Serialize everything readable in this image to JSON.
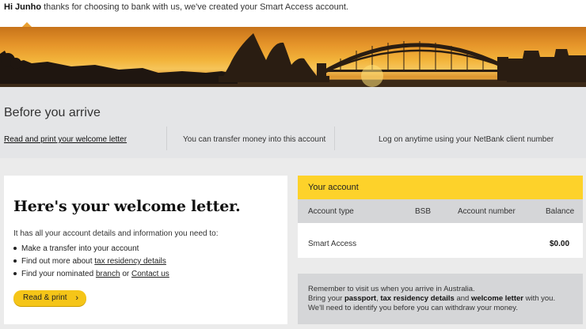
{
  "header": {
    "greeting_name": "Hi Junho",
    "greeting_text": "thanks for choosing to bank with us, we've created your Smart Access account."
  },
  "arrive": {
    "title": "Before you arrive",
    "col1": "Read and print your welcome letter",
    "col2": "You can transfer money into this account",
    "col3": "Log on anytime using your NetBank client number"
  },
  "welcome": {
    "heading": "Here's your welcome letter.",
    "intro": "It has all your account details and information you need to:",
    "item1": "Make a transfer into your account",
    "item2_prefix": "Find out more about",
    "item2_link": "tax residency details",
    "item3_prefix": "Find your nominated",
    "item3_link1": "branch",
    "item3_or": "or",
    "item3_link2": "Contact us",
    "button": "Read & print",
    "button_icon": "chevron-right-icon"
  },
  "account": {
    "title": "Your account",
    "columns": [
      "Account type",
      "BSB",
      "Account number",
      "Balance"
    ],
    "row": {
      "type": "Smart Access",
      "bsb": "",
      "number": "",
      "balance": "$0.00"
    }
  },
  "note": {
    "line1": "Remember to visit us when you arrive in Australia.",
    "line2_a": "Bring your",
    "line2_b": "passport",
    "line2_c": ",",
    "line2_d": "tax residency details",
    "line2_e": "and",
    "line2_f": "welcome letter",
    "line2_g": "with you.",
    "line3": "We'll need to identify you before you can withdraw your money."
  },
  "colors": {
    "accent_yellow": "#fdd22a",
    "button_yellow": "#f5c518",
    "panel_grey": "#e4e5e7"
  }
}
